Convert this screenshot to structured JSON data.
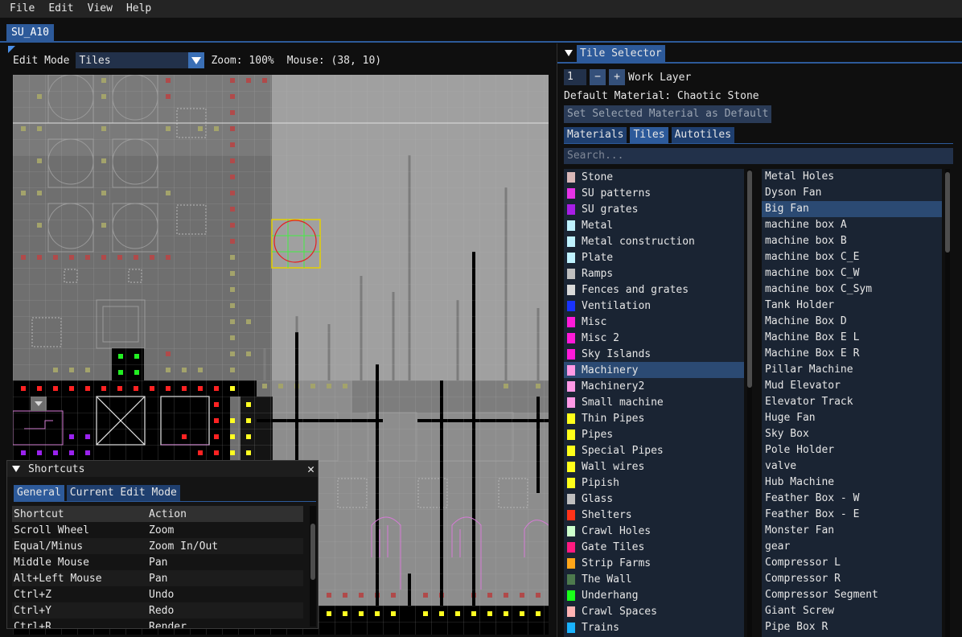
{
  "menu": [
    "File",
    "Edit",
    "View",
    "Help"
  ],
  "document_tab": "SU_A10",
  "toolbar": {
    "edit_mode_label": "Edit Mode",
    "edit_mode_value": "Tiles",
    "zoom": "Zoom: 100%",
    "mouse": "Mouse: (38, 10)"
  },
  "shortcuts": {
    "title": "Shortcuts",
    "close": "✕",
    "tabs": [
      "General",
      "Current Edit Mode"
    ],
    "headers": [
      "Shortcut",
      "Action"
    ],
    "rows": [
      [
        "Scroll Wheel",
        "Zoom"
      ],
      [
        "Equal/Minus",
        "Zoom In/Out"
      ],
      [
        "Middle Mouse",
        "Pan"
      ],
      [
        "Alt+Left Mouse",
        "Pan"
      ],
      [
        "Ctrl+Z",
        "Undo"
      ],
      [
        "Ctrl+Y",
        "Redo"
      ],
      [
        "Ctrl+R",
        "Render"
      ]
    ]
  },
  "tile_selector": {
    "title": "Tile Selector",
    "work_layer_value": "1",
    "minus": "−",
    "plus": "+",
    "work_layer_label": "Work Layer",
    "default_material": "Default Material: Chaotic Stone",
    "set_default_button": "Set Selected Material as Default",
    "tabs": [
      "Materials",
      "Tiles",
      "Autotiles"
    ],
    "search_placeholder": "Search...",
    "categories": [
      {
        "name": "Stone",
        "color": "#d9b8b8"
      },
      {
        "name": "SU patterns",
        "color": "#e633e6"
      },
      {
        "name": "SU grates",
        "color": "#a81ee6"
      },
      {
        "name": "Metal",
        "color": "#bff2ff"
      },
      {
        "name": "Metal construction",
        "color": "#bff2ff"
      },
      {
        "name": "Plate",
        "color": "#bff2ff"
      },
      {
        "name": "Ramps",
        "color": "#bfbfbf"
      },
      {
        "name": "Fences and grates",
        "color": "#d9d9d9"
      },
      {
        "name": "Ventilation",
        "color": "#1933ff"
      },
      {
        "name": "Misc",
        "color": "#ff1ad9"
      },
      {
        "name": "Misc 2",
        "color": "#ff1ad9"
      },
      {
        "name": "Sky Islands",
        "color": "#ff1ad9"
      },
      {
        "name": "Machinery",
        "color": "#ff99e6"
      },
      {
        "name": "Machinery2",
        "color": "#ff99e6"
      },
      {
        "name": "Small machine",
        "color": "#ff99e6"
      },
      {
        "name": "Thin Pipes",
        "color": "#ffff1a"
      },
      {
        "name": "Pipes",
        "color": "#ffff1a"
      },
      {
        "name": "Special Pipes",
        "color": "#ffff1a"
      },
      {
        "name": "Wall wires",
        "color": "#ffff1a"
      },
      {
        "name": "Pipish",
        "color": "#ffff1a"
      },
      {
        "name": "Glass",
        "color": "#bfbfbf"
      },
      {
        "name": "Shelters",
        "color": "#ff3319"
      },
      {
        "name": "Crawl Holes",
        "color": "#ccffcc"
      },
      {
        "name": "Gate Tiles",
        "color": "#ff1a80"
      },
      {
        "name": "Strip Farms",
        "color": "#ffa619"
      },
      {
        "name": "The Wall",
        "color": "#4d7a4d"
      },
      {
        "name": "Underhang",
        "color": "#19ff19"
      },
      {
        "name": "Crawl Spaces",
        "color": "#ffb3b3"
      },
      {
        "name": "Trains",
        "color": "#19b3ff"
      }
    ],
    "selected_category": "Machinery",
    "tiles": [
      "Metal Holes",
      "Dyson Fan",
      "Big Fan",
      "machine box A",
      "machine box B",
      "machine box C_E",
      "machine box C_W",
      "machine box C_Sym",
      "Tank Holder",
      "Machine Box D",
      "Machine Box E L",
      "Machine Box E R",
      "Pillar Machine",
      "Mud Elevator",
      "Elevator Track",
      "Huge Fan",
      "Sky Box",
      "Pole Holder",
      "valve",
      "Hub Machine",
      "Feather Box - W",
      "Feather Box - E",
      "Monster Fan",
      "gear",
      "Compressor L",
      "Compressor R",
      "Compressor Segment",
      "Giant Screw",
      "Pipe Box R"
    ],
    "selected_tile": "Big Fan"
  }
}
